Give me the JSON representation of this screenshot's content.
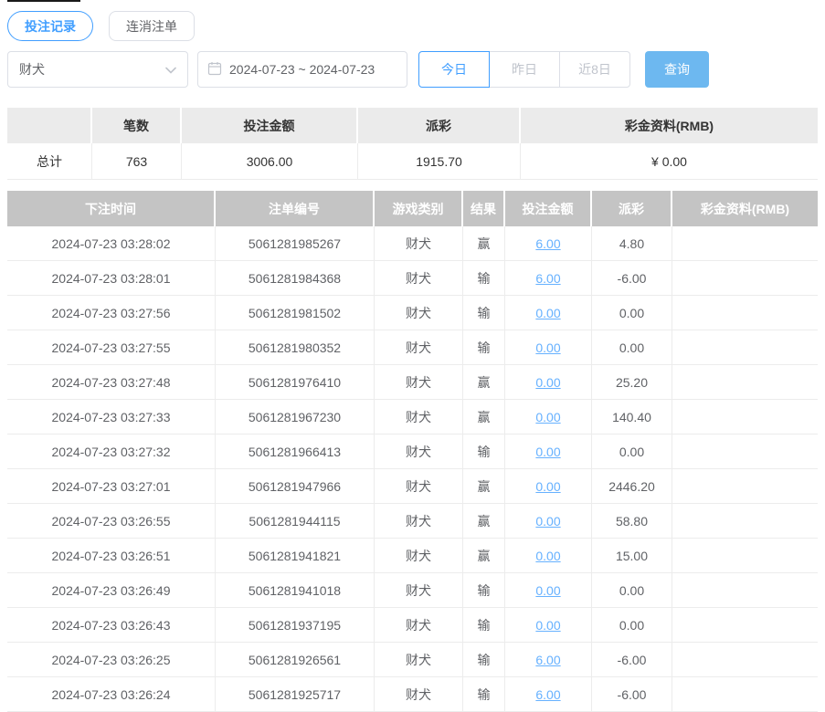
{
  "tabs": [
    {
      "label": "投注记录",
      "active": true
    },
    {
      "label": "连消注单",
      "active": false
    }
  ],
  "filters": {
    "game_select": {
      "value": "财犬"
    },
    "date_range": {
      "value": "2024-07-23 ~ 2024-07-23"
    },
    "quick_buttons": [
      {
        "label": "今日",
        "active": true
      },
      {
        "label": "昨日",
        "active": false
      },
      {
        "label": "近8日",
        "active": false
      }
    ],
    "query_label": "查询"
  },
  "summary": {
    "headers": [
      "",
      "笔数",
      "投注金额",
      "派彩",
      "彩金资料(RMB)"
    ],
    "row": {
      "label": "总计",
      "count": "763",
      "bet_amount": "3006.00",
      "payout": "1915.70",
      "bonus": "¥ 0.00"
    }
  },
  "table": {
    "headers": [
      "下注时间",
      "注单编号",
      "游戏类别",
      "结果",
      "投注金额",
      "派彩",
      "彩金资料(RMB)"
    ],
    "rows": [
      {
        "time": "2024-07-23 03:28:02",
        "order_id": "5061281985267",
        "game": "财犬",
        "result": "赢",
        "bet": "6.00",
        "payout": "4.80",
        "bonus": ""
      },
      {
        "time": "2024-07-23 03:28:01",
        "order_id": "5061281984368",
        "game": "财犬",
        "result": "输",
        "bet": "6.00",
        "payout": "-6.00",
        "bonus": ""
      },
      {
        "time": "2024-07-23 03:27:56",
        "order_id": "5061281981502",
        "game": "财犬",
        "result": "输",
        "bet": "0.00",
        "payout": "0.00",
        "bonus": ""
      },
      {
        "time": "2024-07-23 03:27:55",
        "order_id": "5061281980352",
        "game": "财犬",
        "result": "输",
        "bet": "0.00",
        "payout": "0.00",
        "bonus": ""
      },
      {
        "time": "2024-07-23 03:27:48",
        "order_id": "5061281976410",
        "game": "财犬",
        "result": "赢",
        "bet": "0.00",
        "payout": "25.20",
        "bonus": ""
      },
      {
        "time": "2024-07-23 03:27:33",
        "order_id": "5061281967230",
        "game": "财犬",
        "result": "赢",
        "bet": "0.00",
        "payout": "140.40",
        "bonus": ""
      },
      {
        "time": "2024-07-23 03:27:32",
        "order_id": "5061281966413",
        "game": "财犬",
        "result": "输",
        "bet": "0.00",
        "payout": "0.00",
        "bonus": ""
      },
      {
        "time": "2024-07-23 03:27:01",
        "order_id": "5061281947966",
        "game": "财犬",
        "result": "赢",
        "bet": "0.00",
        "payout": "2446.20",
        "bonus": ""
      },
      {
        "time": "2024-07-23 03:26:55",
        "order_id": "5061281944115",
        "game": "财犬",
        "result": "赢",
        "bet": "0.00",
        "payout": "58.80",
        "bonus": ""
      },
      {
        "time": "2024-07-23 03:26:51",
        "order_id": "5061281941821",
        "game": "财犬",
        "result": "赢",
        "bet": "0.00",
        "payout": "15.00",
        "bonus": ""
      },
      {
        "time": "2024-07-23 03:26:49",
        "order_id": "5061281941018",
        "game": "财犬",
        "result": "输",
        "bet": "0.00",
        "payout": "0.00",
        "bonus": ""
      },
      {
        "time": "2024-07-23 03:26:43",
        "order_id": "5061281937195",
        "game": "财犬",
        "result": "输",
        "bet": "0.00",
        "payout": "0.00",
        "bonus": ""
      },
      {
        "time": "2024-07-23 03:26:25",
        "order_id": "5061281926561",
        "game": "财犬",
        "result": "输",
        "bet": "6.00",
        "payout": "-6.00",
        "bonus": ""
      },
      {
        "time": "2024-07-23 03:26:24",
        "order_id": "5061281925717",
        "game": "财犬",
        "result": "输",
        "bet": "6.00",
        "payout": "-6.00",
        "bonus": ""
      }
    ]
  },
  "colors": {
    "accent_blue": "#409eff",
    "link_blue": "#66b1ff",
    "query_button_bg": "#6db8f0",
    "negative_red": "#f56c6c",
    "table_header_gray": "#c4c4c4",
    "summary_header_gray": "#ebebeb"
  }
}
